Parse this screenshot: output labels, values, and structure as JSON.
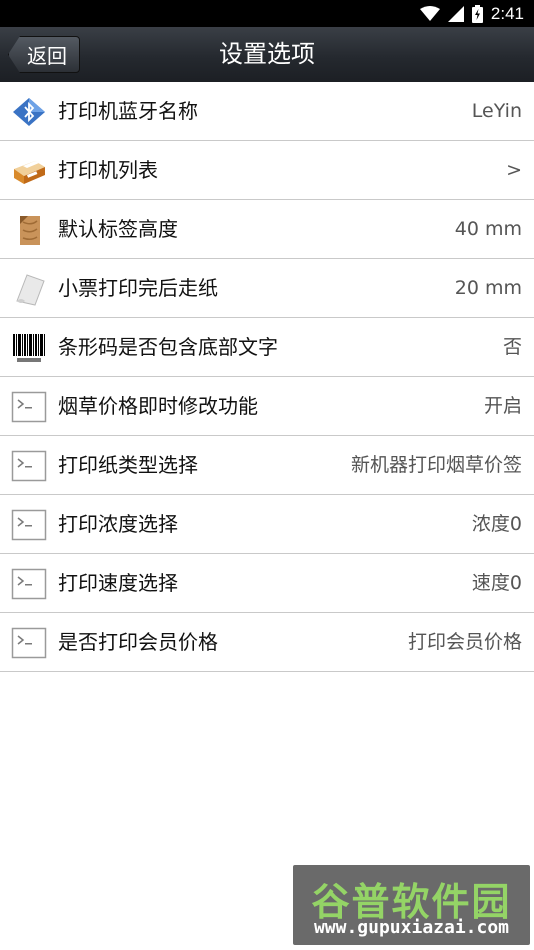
{
  "status_bar": {
    "time": "2:41",
    "icons": [
      "wifi-icon",
      "signal-icon",
      "battery-icon"
    ]
  },
  "header": {
    "back_label": "返回",
    "title": "设置选项"
  },
  "settings": [
    {
      "label": "打印机蓝牙名称",
      "value": "LeYin",
      "icon": "bluetooth-icon"
    },
    {
      "label": "打印机列表",
      "value": ">",
      "icon": "printer-icon"
    },
    {
      "label": "默认标签高度",
      "value": "40 mm",
      "icon": "label-paper-icon"
    },
    {
      "label": "小票打印完后走纸",
      "value": "20 mm",
      "icon": "receipt-paper-icon"
    },
    {
      "label": "条形码是否包含底部文字",
      "value": "否",
      "icon": "barcode-icon"
    },
    {
      "label": "烟草价格即时修改功能",
      "value": "开启",
      "icon": "terminal-icon"
    },
    {
      "label": "打印纸类型选择",
      "value": "新机器打印烟草价签",
      "icon": "terminal-icon"
    },
    {
      "label": "打印浓度选择",
      "value": "浓度0",
      "icon": "terminal-icon"
    },
    {
      "label": "打印速度选择",
      "value": "速度0",
      "icon": "terminal-icon"
    },
    {
      "label": "是否打印会员价格",
      "value": "打印会员价格",
      "icon": "terminal-icon"
    }
  ],
  "watermark": {
    "title": "谷普软件园",
    "url": "www.gupuxiazai.com"
  },
  "colors": {
    "title_bar": "#25292f",
    "divider": "#c9c9c9",
    "value_text": "#555555",
    "watermark_green": "#8bd15a"
  }
}
